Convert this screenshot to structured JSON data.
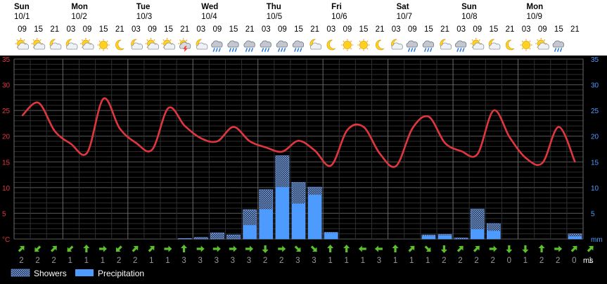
{
  "days": [
    {
      "name": "Sun",
      "date": "10/1"
    },
    {
      "name": "Mon",
      "date": "10/2"
    },
    {
      "name": "Tue",
      "date": "10/3"
    },
    {
      "name": "Wed",
      "date": "10/4"
    },
    {
      "name": "Thu",
      "date": "10/5"
    },
    {
      "name": "Fri",
      "date": "10/6"
    },
    {
      "name": "Sat",
      "date": "10/7"
    },
    {
      "name": "Sun",
      "date": "10/8"
    },
    {
      "name": "Mon",
      "date": "10/9"
    }
  ],
  "hours": [
    "09",
    "15",
    "21",
    "03",
    "09",
    "15",
    "21",
    "03",
    "09",
    "15",
    "21",
    "03",
    "09",
    "15",
    "21",
    "03",
    "09",
    "15",
    "21",
    "03",
    "09",
    "15",
    "21",
    "03",
    "09",
    "15",
    "21",
    "03",
    "09",
    "15",
    "21",
    "03",
    "09",
    "15",
    "21"
  ],
  "icons": [
    "sun-cloud",
    "sun-cloud",
    "moon-cloud",
    "moon-cloud",
    "sun-cloud",
    "sun",
    "moon",
    "moon-cloud",
    "sun-cloud",
    "sun-cloud",
    "lightning-cloud",
    "moon-cloud",
    "rain-cloud",
    "rain-cloud",
    "rain-cloud",
    "rain-cloud",
    "rain-cloud",
    "rain-cloud",
    "moon-cloud",
    "moon",
    "sun",
    "sun",
    "moon",
    "moon-cloud",
    "rain-cloud",
    "rain-cloud",
    "moon-cloud",
    "rain-cloud",
    "sun-cloud",
    "moon-cloud",
    "moon",
    "sun",
    "sun-cloud",
    "rain-cloud"
  ],
  "colors": {
    "background": "#000000",
    "temperature_line": "#e0373f",
    "precipitation_bar": "#4d9bff",
    "wind_arrow": "#5cc02c",
    "left_axis": "#e0373f",
    "right_axis": "#4d9bff"
  },
  "axes": {
    "left_ticks": [
      "35",
      "30",
      "25",
      "20",
      "15",
      "10",
      "5",
      "°C"
    ],
    "right_ticks": [
      "35",
      "30",
      "25",
      "20",
      "15",
      "10",
      "5",
      "mm"
    ],
    "wind_unit": "ms"
  },
  "legend": {
    "showers": "Showers",
    "precipitation": "Precipitation"
  },
  "chart_data": {
    "type": "line",
    "x": [
      "10/1 09",
      "10/1 15",
      "10/1 21",
      "10/2 03",
      "10/2 09",
      "10/2 15",
      "10/2 21",
      "10/3 03",
      "10/3 09",
      "10/3 15",
      "10/3 21",
      "10/4 03",
      "10/4 09",
      "10/4 15",
      "10/4 21",
      "10/5 03",
      "10/5 09",
      "10/5 15",
      "10/5 21",
      "10/6 03",
      "10/6 09",
      "10/6 15",
      "10/6 21",
      "10/7 03",
      "10/7 09",
      "10/7 15",
      "10/7 21",
      "10/8 03",
      "10/8 09",
      "10/8 15",
      "10/8 21",
      "10/9 03",
      "10/9 09",
      "10/9 15",
      "10/9 21"
    ],
    "temperature": [
      24,
      26.5,
      21,
      18.5,
      16.8,
      27.3,
      21.5,
      18.7,
      17.4,
      25.5,
      22,
      19.6,
      19,
      21.8,
      19,
      17.8,
      17,
      19.1,
      17.2,
      14.3,
      21.2,
      21.8,
      16.6,
      14.2,
      21.5,
      23.8,
      18.7,
      17.1,
      16.5,
      25,
      19.7,
      15.7,
      14.8,
      21.8,
      15
    ],
    "precipitation": [
      0,
      0,
      0,
      0,
      0,
      0,
      0,
      0,
      0,
      0,
      0,
      0,
      0,
      0,
      2.7,
      5.8,
      10.1,
      6.9,
      8.6,
      1.2,
      0,
      0,
      0,
      0,
      0,
      0.6,
      0.7,
      0,
      1.9,
      1.6,
      0,
      0,
      0,
      0,
      0.5
    ],
    "showers": [
      0,
      0,
      0,
      0,
      0,
      0,
      0,
      0,
      0,
      0,
      0.1,
      0.3,
      1.2,
      0.8,
      5.7,
      9.6,
      16.2,
      11.0,
      10.1,
      1.3,
      0,
      0,
      0,
      0,
      0,
      0.8,
      0.9,
      0.2,
      5.8,
      3.0,
      0,
      0,
      0,
      0,
      1.0
    ],
    "wind_speed": [
      2,
      2,
      2,
      1,
      1,
      1,
      2,
      2,
      1,
      1,
      3,
      3,
      3,
      3,
      3,
      2,
      2,
      3,
      3,
      1,
      1,
      1,
      3,
      1,
      1,
      1,
      2,
      2,
      2,
      2,
      0,
      1,
      2,
      2,
      0,
      1
    ],
    "wind_direction": [
      "NE",
      "SW",
      "NE",
      "SW",
      "N",
      "E",
      "SW",
      "NE",
      "NE",
      "E",
      "N",
      "E",
      "E",
      "E",
      "E",
      "S",
      "E",
      "SE",
      "SE",
      "N",
      "N",
      "W",
      "W",
      "N",
      "NE",
      "SE",
      "S",
      "NE",
      "NE",
      "E",
      "S",
      "S",
      "N",
      "E",
      "NE",
      "NE"
    ],
    "ylim": [
      0,
      35
    ],
    "y2lim": [
      0,
      35
    ],
    "ylabel": "°C",
    "y2label": "mm"
  }
}
